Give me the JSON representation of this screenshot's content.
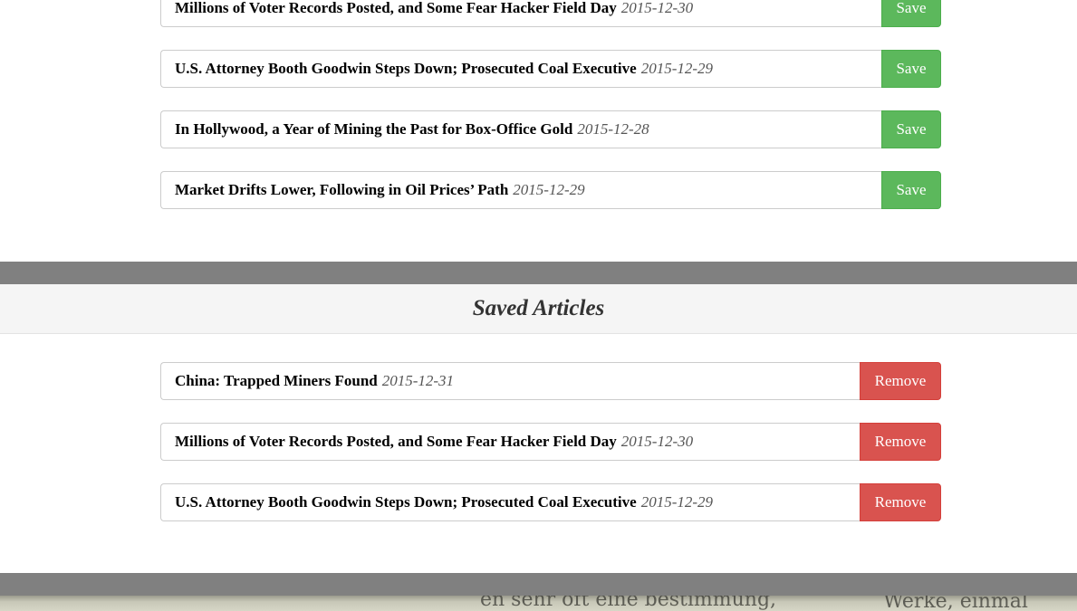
{
  "search_results": [
    {
      "title": "Millions of Voter Records Posted, and Some Fear Hacker Field Day",
      "date": "2015-12-30",
      "button": "Save"
    },
    {
      "title": "U.S. Attorney Booth Goodwin Steps Down; Prosecuted Coal Executive",
      "date": "2015-12-29",
      "button": "Save"
    },
    {
      "title": "In Hollywood, a Year of Mining the Past for Box-Office Gold",
      "date": "2015-12-28",
      "button": "Save"
    },
    {
      "title": "Market Drifts Lower, Following in Oil Prices’ Path",
      "date": "2015-12-29",
      "button": "Save"
    }
  ],
  "saved_section": {
    "heading": "Saved Articles",
    "articles": [
      {
        "title": "China: Trapped Miners Found",
        "date": "2015-12-31",
        "button": "Remove"
      },
      {
        "title": "Millions of Voter Records Posted, and Some Fear Hacker Field Day",
        "date": "2015-12-30",
        "button": "Remove"
      },
      {
        "title": "U.S. Attorney Booth Goodwin Steps Down; Prosecuted Coal Executive",
        "date": "2015-12-29",
        "button": "Remove"
      }
    ]
  },
  "background_photo": {
    "text_fragment_1": "en sehr oft eine bestimmung,",
    "text_fragment_2": "Werke, einmal"
  },
  "colors": {
    "save_button": "#5cb85c",
    "remove_button": "#d9534f",
    "divider": "#808080",
    "section_header_bg": "#f5f5f5"
  }
}
